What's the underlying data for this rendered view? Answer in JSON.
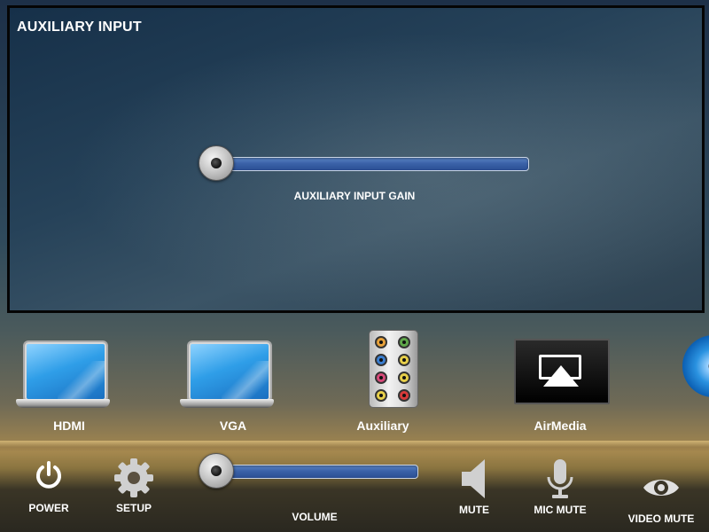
{
  "panel": {
    "title": "AUXILIARY INPUT",
    "gain_label": "AUXILIARY INPUT GAIN",
    "gain_level": 0
  },
  "sources": [
    {
      "label": "HDMI",
      "icon": "laptop-icon"
    },
    {
      "label": "VGA",
      "icon": "laptop-icon"
    },
    {
      "label": "Auxiliary",
      "icon": "rca-jacks-icon"
    },
    {
      "label": "AirMedia",
      "icon": "airplay-icon"
    },
    {
      "label": "",
      "icon": "disc-icon"
    }
  ],
  "controls": {
    "power": "POWER",
    "setup": "SETUP",
    "volume": "VOLUME",
    "volume_level": 0,
    "mute": "MUTE",
    "mic_mute": "MIC MUTE",
    "video_mute": "VIDEO MUTE"
  },
  "colors": {
    "slider_track": "#3b62a8",
    "airmedia_bg": "#000000"
  }
}
